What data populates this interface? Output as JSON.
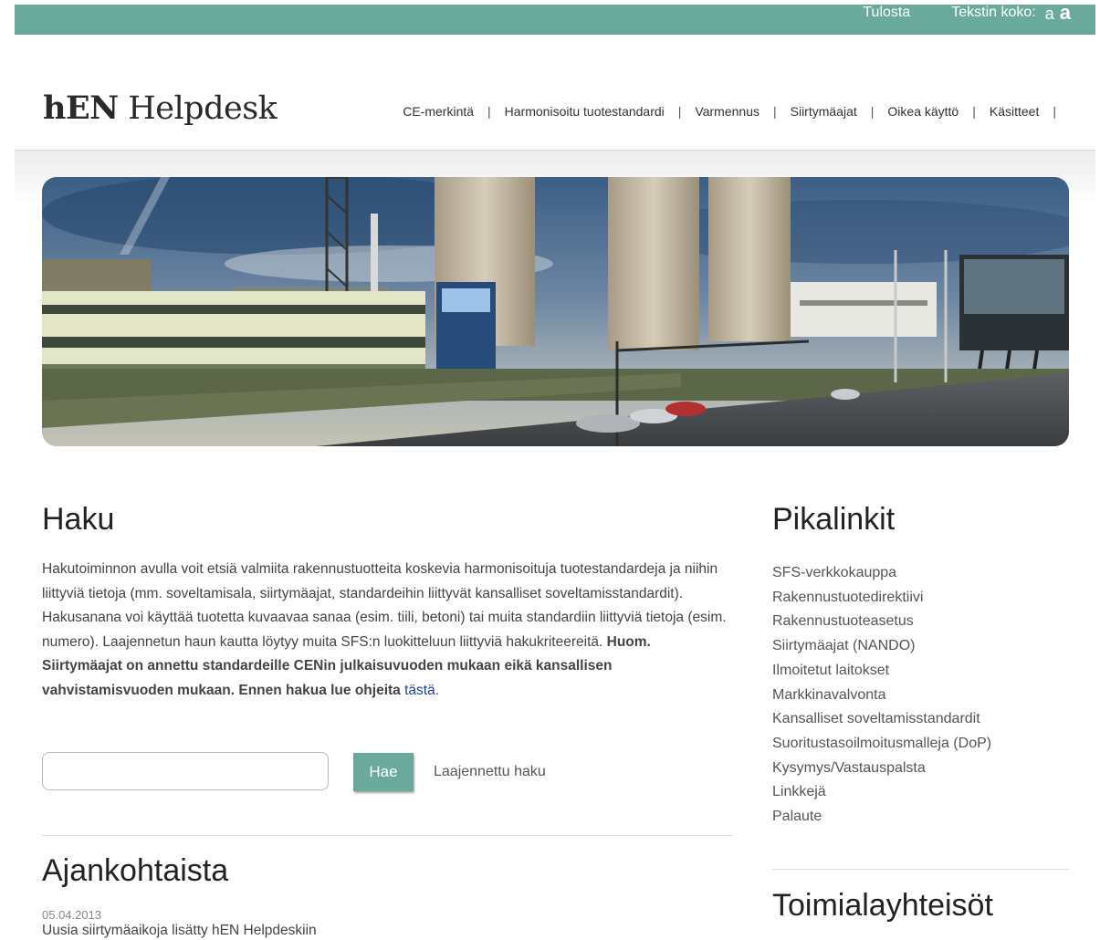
{
  "topbar": {
    "print_label": "Tulosta",
    "text_size_label": "Tekstin koko:",
    "size_small": "a",
    "size_large": "a"
  },
  "header": {
    "logo_bold": "hEN",
    "logo_rest": " Helpdesk",
    "nav": [
      {
        "label": "CE-merkintä"
      },
      {
        "label": "Harmonisoitu tuotestandardi"
      },
      {
        "label": "Varmennus"
      },
      {
        "label": "Siirtymäajat"
      },
      {
        "label": "Oikea käyttö"
      },
      {
        "label": "Käsitteet"
      }
    ],
    "nav_separator": "|"
  },
  "search": {
    "title": "Haku",
    "intro_text": "Hakutoiminnon avulla voit etsiä valmiita  rakennustuotteita koskevia harmonisoituja tuotestandardeja ja niihin liittyviä tietoja (mm. soveltamisala, siirtymäajat, standardeihin liittyvät kansalliset soveltamisstandardit). Hakusanana voi käyttää tuotetta kuvaavaa sanaa (esim. tiili, betoni) tai muita standardiin liittyviä tietoja (esim. numero). Laajennetun haun kautta löytyy muita SFS:n luokitteluun liittyviä hakukriteereitä. ",
    "intro_bold": "Huom. Siirtymäajat on annettu standardeille CENin julkaisuvuoden mukaan eikä  kansallisen vahvistamisvuoden mukaan. Ennen hakua lue ohjeita ",
    "intro_link": "tästä",
    "intro_end": ".",
    "input_value": "",
    "button_label": "Hae",
    "advanced_label": "Laajennettu haku"
  },
  "news": {
    "title": "Ajankohtaista",
    "items": [
      {
        "date": "05.04.2013",
        "text": "Uusia siirtymäaikoja lisätty hEN Helpdeskiin"
      }
    ]
  },
  "quicklinks": {
    "title": "Pikalinkit",
    "items": [
      {
        "label": "SFS-verkkokauppa"
      },
      {
        "label": "Rakennustuotedirektiivi"
      },
      {
        "label": "Rakennustuoteasetus"
      },
      {
        "label": "Siirtymäajat (NANDO)"
      },
      {
        "label": "Ilmoitetut laitokset"
      },
      {
        "label": "Markkinavalvonta"
      },
      {
        "label": "Kansalliset soveltamisstandardit"
      },
      {
        "label": "Suoritustasoilmoitusmalleja (DoP)"
      },
      {
        "label": "Kysymys/Vastauspalsta"
      },
      {
        "label": "Linkkejä"
      },
      {
        "label": "Palaute"
      }
    ]
  },
  "industry": {
    "title": "Toimialayhteisöt"
  },
  "colors": {
    "accent": "#6aaa9d",
    "link": "#1b3f9a"
  }
}
